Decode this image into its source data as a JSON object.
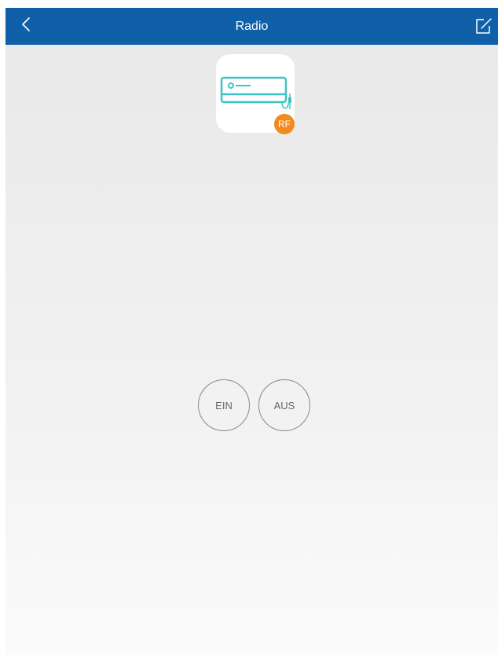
{
  "header": {
    "title": "Radio",
    "back_icon": "chevron-left-icon",
    "edit_icon": "edit-icon",
    "background_color": "#0f5fa9"
  },
  "device": {
    "icon": "air-conditioner-icon",
    "badge_label": "RF",
    "icon_color": "#3cc6c0",
    "badge_color": "#f28a1c"
  },
  "controls": {
    "on_label": "EIN",
    "off_label": "AUS"
  }
}
